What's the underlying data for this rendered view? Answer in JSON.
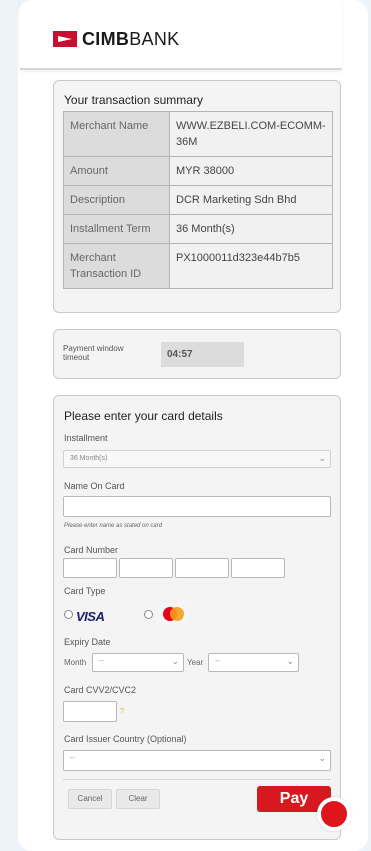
{
  "brand": {
    "name_bold": "CIMB",
    "name_light": "BANK"
  },
  "summary": {
    "title": "Your transaction summary",
    "rows": [
      {
        "key": "Merchant Name",
        "value": "WWW.EZBELI.COM-ECOMM-36M"
      },
      {
        "key": "Amount",
        "value": "MYR 38000"
      },
      {
        "key": "Description",
        "value": "DCR Marketing Sdn Bhd"
      },
      {
        "key": "Installment Term",
        "value": "36 Month(s)"
      },
      {
        "key": "Merchant Transaction ID",
        "value": "PX1000011d323e44b7b5"
      }
    ]
  },
  "timeout": {
    "label": "Payment window timeout",
    "value": "04:57"
  },
  "card_form": {
    "title": "Please enter your card details",
    "installment_label": "Installment",
    "installment_value": "36 Month(s)",
    "name_label": "Name On Card",
    "name_value": "",
    "name_hint": "Please enter name as stated on card",
    "card_number_label": "Card Number",
    "card_type_label": "Card Type",
    "card_type_visa": "VISA",
    "expiry_label": "Expiry Date",
    "month_label": "Month",
    "month_value": "--",
    "year_label": "Year",
    "year_value": "--",
    "cvv_label": "Card CVV2/CVC2",
    "cvv_hint": "?",
    "country_label": "Card Issuer Country (Optional)",
    "country_value": "--",
    "cancel_label": "Cancel",
    "clear_label": "Clear",
    "pay_label": "Pay"
  },
  "colors": {
    "accent": "#d7191f",
    "panel": "#f4f4f4",
    "page_bg": "#eef3f9"
  },
  "icons": {
    "chevron": "chevron-down-icon",
    "mastercard": "mastercard-icon"
  }
}
